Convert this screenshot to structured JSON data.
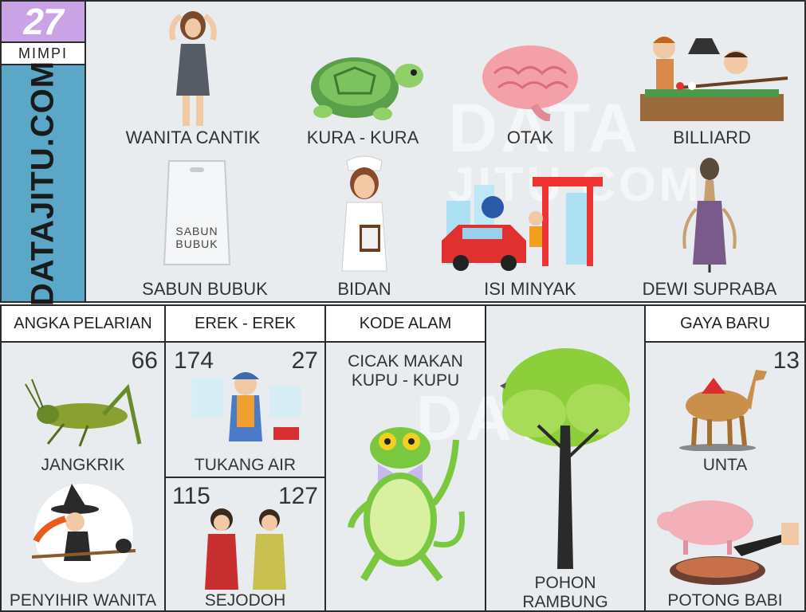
{
  "number": "27",
  "mimpi_label": "MIMPI",
  "brand": "DATAJITU.COM",
  "watermark": [
    "DATA",
    "JITU.COM"
  ],
  "top_items": [
    {
      "label": "WANITA CANTIK",
      "icon": "woman-posing-icon"
    },
    {
      "label": "KURA - KURA",
      "icon": "turtle-icon"
    },
    {
      "label": "OTAK",
      "icon": "brain-icon"
    },
    {
      "label": "BILLIARD",
      "icon": "billiard-icon"
    },
    {
      "label": "SABUN BUBUK",
      "icon": "detergent-bag-icon",
      "bag_text": "SABUN BUBUK"
    },
    {
      "label": "BIDAN",
      "icon": "midwife-icon"
    },
    {
      "label": "ISI MINYAK",
      "icon": "gas-station-icon"
    },
    {
      "label": "DEWI SUPRABA",
      "icon": "wayang-puppet-icon"
    }
  ],
  "angka_pelarian": {
    "header": "ANGKA PELARIAN",
    "number": "66",
    "item1": "JANGKRIK",
    "item2": "PENYIHIR WANITA"
  },
  "erek": {
    "header": "EREK - EREK",
    "cell1": {
      "left": "174",
      "right": "27",
      "label": "TUKANG AIR"
    },
    "cell2": {
      "left": "115",
      "right": "127",
      "label": "SEJODOH"
    }
  },
  "kode_alam": {
    "header": "KODE ALAM",
    "title_line1": "CICAK MAKAN",
    "title_line2": "KUPU - KUPU"
  },
  "pohon": {
    "line1": "POHON",
    "line2": "RAMBUNG"
  },
  "gaya_baru": {
    "header": "GAYA BARU",
    "number": "13",
    "item1": "UNTA",
    "item2": "POTONG BABI"
  }
}
